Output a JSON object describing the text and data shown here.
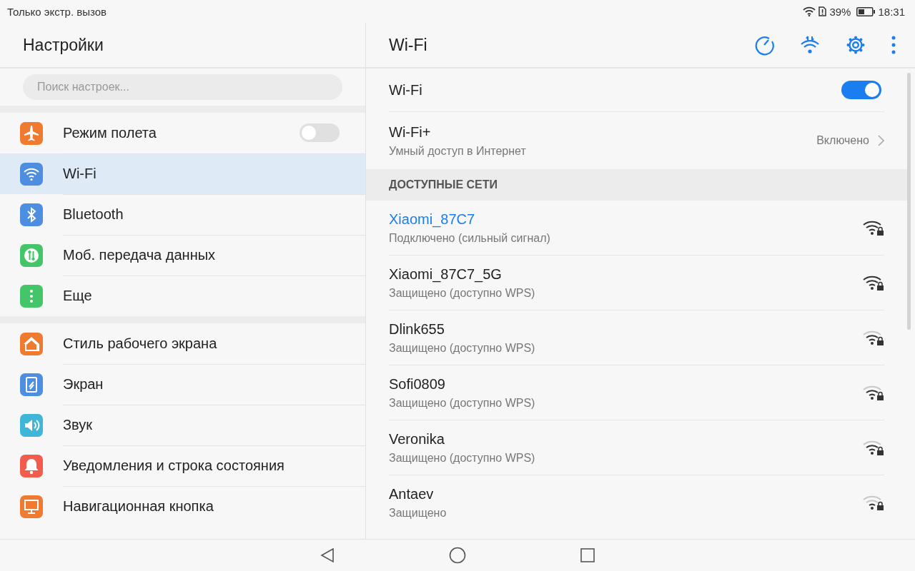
{
  "status_bar": {
    "carrier": "Только экстр. вызов",
    "battery": "39%",
    "time": "18:31"
  },
  "sidebar": {
    "title": "Настройки",
    "search": {
      "placeholder": "Поиск настроек..."
    },
    "groups": [
      {
        "items": [
          {
            "label": "Режим полета",
            "kind": "airplane",
            "color": "#f07a2f",
            "selected": false,
            "switch": {
              "on": false
            }
          },
          {
            "label": "Wi-Fi",
            "kind": "wifi",
            "color": "#4d8ee0",
            "selected": true
          },
          {
            "label": "Bluetooth",
            "kind": "bluetooth",
            "color": "#4d8ee0",
            "selected": false
          },
          {
            "label": "Моб. передача данных",
            "kind": "data",
            "color": "#45c56a",
            "selected": false
          },
          {
            "label": "Еще",
            "kind": "more",
            "color": "#45c56a",
            "selected": false
          }
        ]
      },
      {
        "items": [
          {
            "label": "Стиль рабочего экрана",
            "kind": "home",
            "color": "#f07a2f",
            "selected": false
          },
          {
            "label": "Экран",
            "kind": "display",
            "color": "#4d8ee0",
            "selected": false
          },
          {
            "label": "Звук",
            "kind": "sound",
            "color": "#3fb5d8",
            "selected": false
          },
          {
            "label": "Уведомления и строка состояния",
            "kind": "bell",
            "color": "#f25c4c",
            "selected": false
          },
          {
            "label": "Навигационная кнопка",
            "kind": "nav",
            "color": "#f07a2f",
            "selected": false
          }
        ]
      }
    ]
  },
  "panel": {
    "title": "Wi-Fi",
    "wifi": {
      "label": "Wi-Fi",
      "on": true
    },
    "wifi_plus": {
      "label": "Wi-Fi+",
      "subtitle": "Умный доступ в Интернет",
      "value": "Включено"
    },
    "section": "ДОСТУПНЫЕ СЕТИ",
    "networks": [
      {
        "name": "Xiaomi_87C7",
        "status": "Подключено (сильный сигнал)",
        "connected": true,
        "kind": "full"
      },
      {
        "name": "Xiaomi_87C7_5G",
        "status": "Защищено (доступно WPS)",
        "connected": false,
        "kind": "full"
      },
      {
        "name": "Dlink655",
        "status": "Защищено (доступно WPS)",
        "connected": false,
        "kind": "good"
      },
      {
        "name": "Sofi0809",
        "status": "Защищено (доступно WPS)",
        "connected": false,
        "kind": "good"
      },
      {
        "name": "Veronika",
        "status": "Защищено (доступно WPS)",
        "connected": false,
        "kind": "good"
      },
      {
        "name": "Antaev",
        "status": "Защищено",
        "connected": false,
        "kind": "fair"
      }
    ]
  }
}
